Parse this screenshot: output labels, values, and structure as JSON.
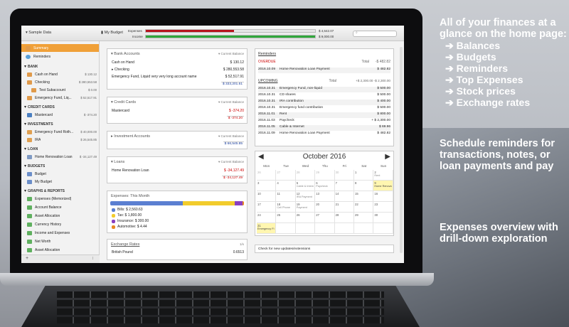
{
  "app": {
    "document_name": "Sample Data",
    "budget_label": "My Budget",
    "expenses_label": "Expenses",
    "income_label": "Income",
    "expenses_value": "$ 4,642.07",
    "income_value": "$ 9,000.00",
    "expenses_ratio": 0.52,
    "income_ratio": 1.0,
    "search_placeholder": ""
  },
  "sidebar": {
    "summary": "Summary",
    "reminders": "Reminders",
    "sections": [
      {
        "title": "BANK",
        "items": [
          {
            "label": "Cash on Hand",
            "value": "$ 130.12"
          },
          {
            "label": "Checking",
            "value": "$ 280,553.58"
          },
          {
            "label": "Test Subaccount",
            "value": "$ 0.00"
          },
          {
            "label": "Emergency Fund, Liq...",
            "value": "$ 52,517.91"
          }
        ]
      },
      {
        "title": "CREDIT CARDS",
        "items": [
          {
            "label": "Mastercard",
            "value": "$ -374.20"
          }
        ]
      },
      {
        "title": "INVESTMENTS",
        "items": [
          {
            "label": "Emergency Fund Roth...",
            "value": "$ 40,000.00"
          },
          {
            "label": "IRA",
            "value": "$ 26,545.85"
          }
        ]
      },
      {
        "title": "LOAN",
        "items": [
          {
            "label": "Home Renovation Loan",
            "value": "$ -34,127.49"
          }
        ]
      },
      {
        "title": "BUDGETS",
        "items": [
          {
            "label": "Budget",
            "value": ""
          },
          {
            "label": "My Budget",
            "value": ""
          }
        ]
      },
      {
        "title": "GRAPHS & REPORTS",
        "items": [
          {
            "label": "Expenses (Memorized)",
            "value": ""
          },
          {
            "label": "Account Balance",
            "value": ""
          },
          {
            "label": "Asset Allocation",
            "value": ""
          },
          {
            "label": "Currency History",
            "value": ""
          },
          {
            "label": "Income and Expenses",
            "value": ""
          },
          {
            "label": "Net Worth",
            "value": ""
          },
          {
            "label": "Asset Allocation",
            "value": ""
          }
        ]
      }
    ]
  },
  "bank": {
    "title": "Bank Accounts",
    "col": "Current Balance",
    "rows": [
      {
        "name": "Cash on Hand",
        "value": "$ 130.12"
      },
      {
        "name": "Checking",
        "value": "$ 280,553.58"
      },
      {
        "name": "Emergency Fund, Liquid very very long account name",
        "value": "$ 52,517.91"
      }
    ],
    "total": "$ 333,201.61"
  },
  "credit": {
    "title": "Credit Cards",
    "col": "Current Balance",
    "rows": [
      {
        "name": "Mastercard",
        "value": "$ -374.20"
      }
    ],
    "total": "$ -374.20"
  },
  "investments": {
    "title": "Investment Accounts",
    "col": "Current Balance",
    "total": "$ 66,545.85"
  },
  "loans": {
    "title": "Loans",
    "col": "Current Balance",
    "rows": [
      {
        "name": "Home Renovation Loan",
        "value": "$ -34,127.49"
      }
    ],
    "total": "$ -34,127.49"
  },
  "expenses_month": {
    "title": "Expenses: This Month",
    "legend": [
      {
        "label": "Bills: $ 2,560.63",
        "color": "#5b7fd1",
        "share": 0.55
      },
      {
        "label": "Tax: $ 1,800.00",
        "color": "#f2cc2c",
        "share": 0.39
      },
      {
        "label": "Insurance: $ 300.00",
        "color": "#8a3fc0",
        "share": 0.06
      },
      {
        "label": "Automotive: $ 4.44",
        "color": "#e98a24",
        "share": 0.01
      }
    ]
  },
  "exchange": {
    "title": "Exchange Rates",
    "page": "1/x",
    "first_row": "British Pound",
    "first_value": "0.6513"
  },
  "reminders": {
    "title": "Reminders",
    "overdue_label": "OVERDUE",
    "overdue_total_label": "Total",
    "overdue_total": "-$ 482.82",
    "overdue": [
      {
        "date": "2016.10.09",
        "name": "Home Renovation Loan Payment",
        "amount": "$ 482.82"
      }
    ],
    "upcoming_label": "UPCOMING",
    "upcoming_total_label": "Total",
    "upcoming_total": "+$ 2,300.00 -$ 2,300.00",
    "upcoming": [
      {
        "date": "2016.10.31",
        "name": "Emergency Fund, non-liquid",
        "amount": "$ 500.00"
      },
      {
        "date": "2016.10.31",
        "name": "CD shares",
        "amount": "$ 500.00"
      },
      {
        "date": "2016.10.31",
        "name": "IRA contribution",
        "amount": "$ 400.00"
      },
      {
        "date": "2016.10.31",
        "name": "Emergency fund contribution",
        "amount": "$ 500.00"
      },
      {
        "date": "2016.11.01",
        "name": "Rent",
        "amount": "$ 800.00"
      },
      {
        "date": "2016.11.03",
        "name": "Paycheck",
        "amount": "+ $ 2,300.00"
      },
      {
        "date": "2016.11.05",
        "name": "Cable & Internet",
        "amount": "$ 69.96"
      },
      {
        "date": "2016.11.09",
        "name": "Home Renovation Loan Payment",
        "amount": "$ 482.82"
      }
    ]
  },
  "calendar": {
    "title": "October 2016",
    "prev": "◀",
    "next": "▶",
    "dow": [
      "Mon",
      "Tue",
      "Wed",
      "Thu",
      "Fri",
      "Sat",
      "Sun"
    ],
    "cells": [
      {
        "d": "26",
        "ev": "",
        "dim": true
      },
      {
        "d": "27",
        "ev": "",
        "dim": true
      },
      {
        "d": "28",
        "ev": "",
        "dim": true
      },
      {
        "d": "29",
        "ev": "",
        "dim": true
      },
      {
        "d": "30",
        "ev": "",
        "dim": true
      },
      {
        "d": "1",
        "ev": ""
      },
      {
        "d": "2",
        "ev": "Rent"
      },
      {
        "d": "3",
        "ev": ""
      },
      {
        "d": "4",
        "ev": ""
      },
      {
        "d": "5",
        "ev": "Cable & Internet"
      },
      {
        "d": "6",
        "ev": "Paycheck"
      },
      {
        "d": "7",
        "ev": ""
      },
      {
        "d": "8",
        "ev": ""
      },
      {
        "d": "9",
        "ev": "Home Renova",
        "hl": true
      },
      {
        "d": "10",
        "ev": ""
      },
      {
        "d": "11",
        "ev": ""
      },
      {
        "d": "12",
        "ev": "IRA Payment"
      },
      {
        "d": "13",
        "ev": ""
      },
      {
        "d": "14",
        "ev": ""
      },
      {
        "d": "15",
        "ev": ""
      },
      {
        "d": "16",
        "ev": ""
      },
      {
        "d": "17",
        "ev": ""
      },
      {
        "d": "18",
        "ev": "Cell Phone"
      },
      {
        "d": "19",
        "ev": "Payment"
      },
      {
        "d": "20",
        "ev": ""
      },
      {
        "d": "21",
        "ev": ""
      },
      {
        "d": "22",
        "ev": ""
      },
      {
        "d": "23",
        "ev": ""
      },
      {
        "d": "24",
        "ev": ""
      },
      {
        "d": "25",
        "ev": ""
      },
      {
        "d": "26",
        "ev": ""
      },
      {
        "d": "27",
        "ev": ""
      },
      {
        "d": "28",
        "ev": ""
      },
      {
        "d": "29",
        "ev": ""
      },
      {
        "d": "30",
        "ev": ""
      },
      {
        "d": "31",
        "ev": "Emergency Fi CD shares",
        "hl": true
      },
      {
        "d": "",
        "ev": ""
      },
      {
        "d": "",
        "ev": ""
      },
      {
        "d": "",
        "ev": ""
      },
      {
        "d": "",
        "ev": ""
      },
      {
        "d": "",
        "ev": ""
      },
      {
        "d": "",
        "ev": ""
      }
    ]
  },
  "updates_link": "Check for new updates/extensions",
  "promo": {
    "heading1": "All of your finances at a glance on the home page:",
    "bullets": [
      "➔ Balances",
      "➔ Budgets",
      "➔ Reminders",
      "➔ Top Expenses",
      "➔ Stock prices",
      "➔ Exchange rates"
    ],
    "heading2": "Schedule reminders for transactions, notes, or loan payments and pay",
    "heading3": "Expenses overview with drill-down exploration"
  }
}
